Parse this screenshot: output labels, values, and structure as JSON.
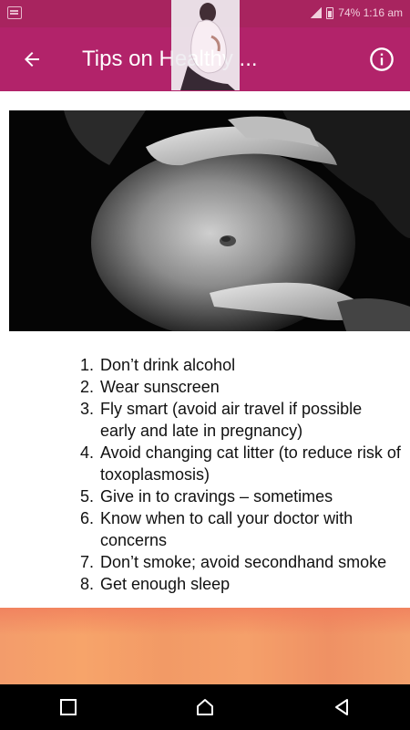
{
  "status_bar": {
    "status_text": "74% 1:16 am"
  },
  "app_bar": {
    "title": "Tips on Healthy ..."
  },
  "tips": [
    {
      "num": "1.",
      "text": "Don’t drink alcohol"
    },
    {
      "num": "2.",
      "text": "Wear sunscreen"
    },
    {
      "num": "3.",
      "text": "Fly smart (avoid air travel if possible early and late in pregnancy)"
    },
    {
      "num": "4.",
      "text": "Avoid changing cat litter (to reduce risk of toxoplasmosis)"
    },
    {
      "num": "5.",
      "text": "Give in to cravings – sometimes"
    },
    {
      "num": "6.",
      "text": "Know when to call your doctor with concerns"
    },
    {
      "num": "7.",
      "text": "Don’t smoke; avoid secondhand smoke"
    },
    {
      "num": "8.",
      "text": "Get enough sleep"
    }
  ],
  "colors": {
    "app_bar": "#b2236a",
    "status_bar": "#a8245f",
    "ad_banner": "#f5a06a",
    "nav_bar": "#000000"
  },
  "icons": {
    "back": "arrow-left-icon",
    "info": "info-circle-icon",
    "nav_recents": "square-icon",
    "nav_home": "home-icon",
    "nav_back": "triangle-back-icon"
  }
}
